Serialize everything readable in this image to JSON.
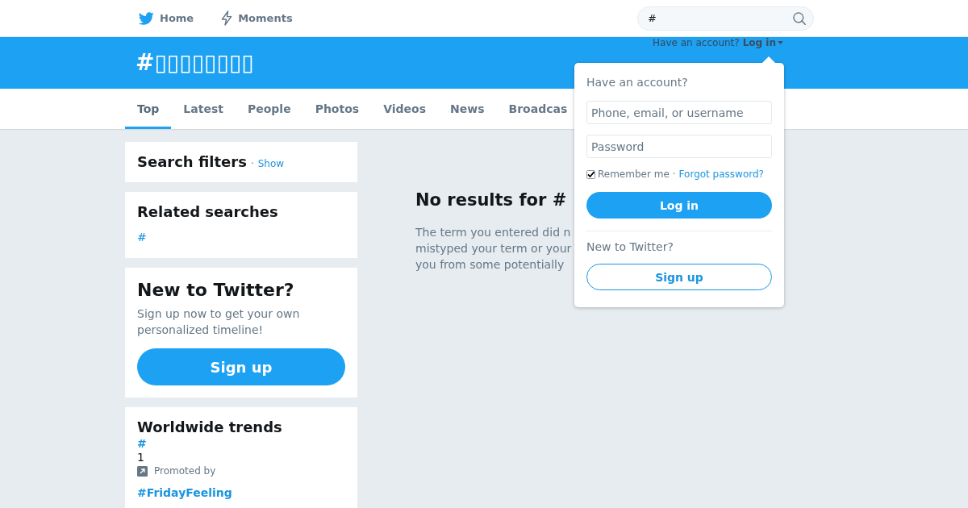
{
  "nav": {
    "items": [
      {
        "kind": "home",
        "label": "Home"
      },
      {
        "kind": "moments",
        "label": "Moments"
      }
    ]
  },
  "search": {
    "value": "#"
  },
  "header": {
    "title": "#▯▯▯▯▯▯▯▯"
  },
  "login_menu": {
    "prompt": "Have an account?",
    "toggle": "Log in",
    "expanded": true,
    "form": {
      "heading": "Have an account?",
      "fields": [
        {
          "placeholder": "Phone, email, or username"
        },
        {
          "placeholder": "Password"
        }
      ],
      "remember": {
        "label": "Remember me",
        "checked": true
      },
      "separator": "·",
      "forgot_link": "Forgot password?",
      "submit": "Log in",
      "signup_prompt": "New to Twitter?",
      "signup_button": "Sign up"
    }
  },
  "tabs": [
    {
      "label": "Top",
      "selected": true
    },
    {
      "label": "Latest",
      "selected": false
    },
    {
      "label": "People",
      "selected": false
    },
    {
      "label": "Photos",
      "selected": false
    },
    {
      "label": "Videos",
      "selected": false
    },
    {
      "label": "News",
      "selected": false
    },
    {
      "label": "Broadcas",
      "selected": false
    }
  ],
  "sidebar": {
    "search_filters": {
      "title": "Search filters",
      "separator": "·",
      "link": "Show"
    },
    "related_searches": {
      "title": "Related searches",
      "items": [
        "#"
      ]
    },
    "signup_card": {
      "title": "New to Twitter?",
      "text": "Sign up now to get your own personalized timeline!",
      "button": "Sign up"
    },
    "trends": {
      "title": "Worldwide trends",
      "items": [
        {
          "name": "#",
          "description": "1",
          "promoted": "Promoted by"
        },
        {
          "name": "#FridayFeeling"
        }
      ]
    }
  },
  "results": {
    "title": "No results for #",
    "message_lines": [
      "The term you entered did n",
      "mistyped your term or your",
      "you from some potentially"
    ]
  }
}
